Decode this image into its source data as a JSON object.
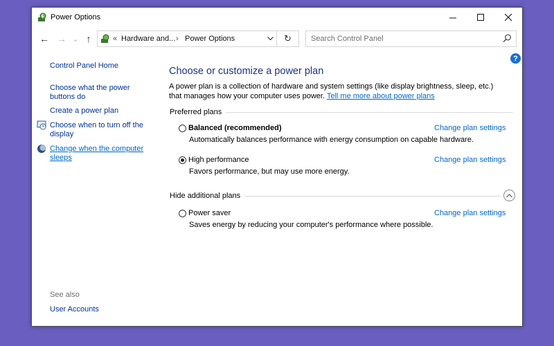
{
  "window": {
    "title": "Power Options",
    "controls": {
      "minimize": "─",
      "maximize": "☐",
      "close": "✕"
    }
  },
  "toolbar": {
    "back": "←",
    "forward": "→",
    "recent": "⌄",
    "up": "↑",
    "breadcrumb": [
      "«",
      "Hardware and...",
      "›",
      "Power Options"
    ],
    "refresh": "↻",
    "search_placeholder": "Search Control Panel",
    "help": "?"
  },
  "sidebar": {
    "home": "Control Panel Home",
    "links": [
      "Choose what the power buttons do",
      "Create a power plan",
      "Choose when to turn off the display",
      "Change when the computer sleeps"
    ],
    "see_also_label": "See also",
    "see_also_links": [
      "User Accounts"
    ]
  },
  "main": {
    "title": "Choose or customize a power plan",
    "description": "A power plan is a collection of hardware and system settings (like display brightness, sleep, etc.) that manages how your computer uses power.",
    "learn_more": "Tell me more about power plans",
    "preferred_label": "Preferred plans",
    "additional_label": "Hide additional plans",
    "change_settings_label": "Change plan settings",
    "plans": [
      {
        "name": "Balanced (recommended)",
        "description": "Automatically balances performance with energy consumption on capable hardware.",
        "selected": false
      },
      {
        "name": "High performance",
        "description": "Favors performance, but may use more energy.",
        "selected": true
      },
      {
        "name": "Power saver",
        "description": "Saves energy by reducing your computer's performance where possible.",
        "selected": false
      }
    ]
  },
  "colors": {
    "desktop": "#6a5fc1",
    "title_text": "#1e3287",
    "link": "#0066cc",
    "sidebar_link": "#003399"
  }
}
